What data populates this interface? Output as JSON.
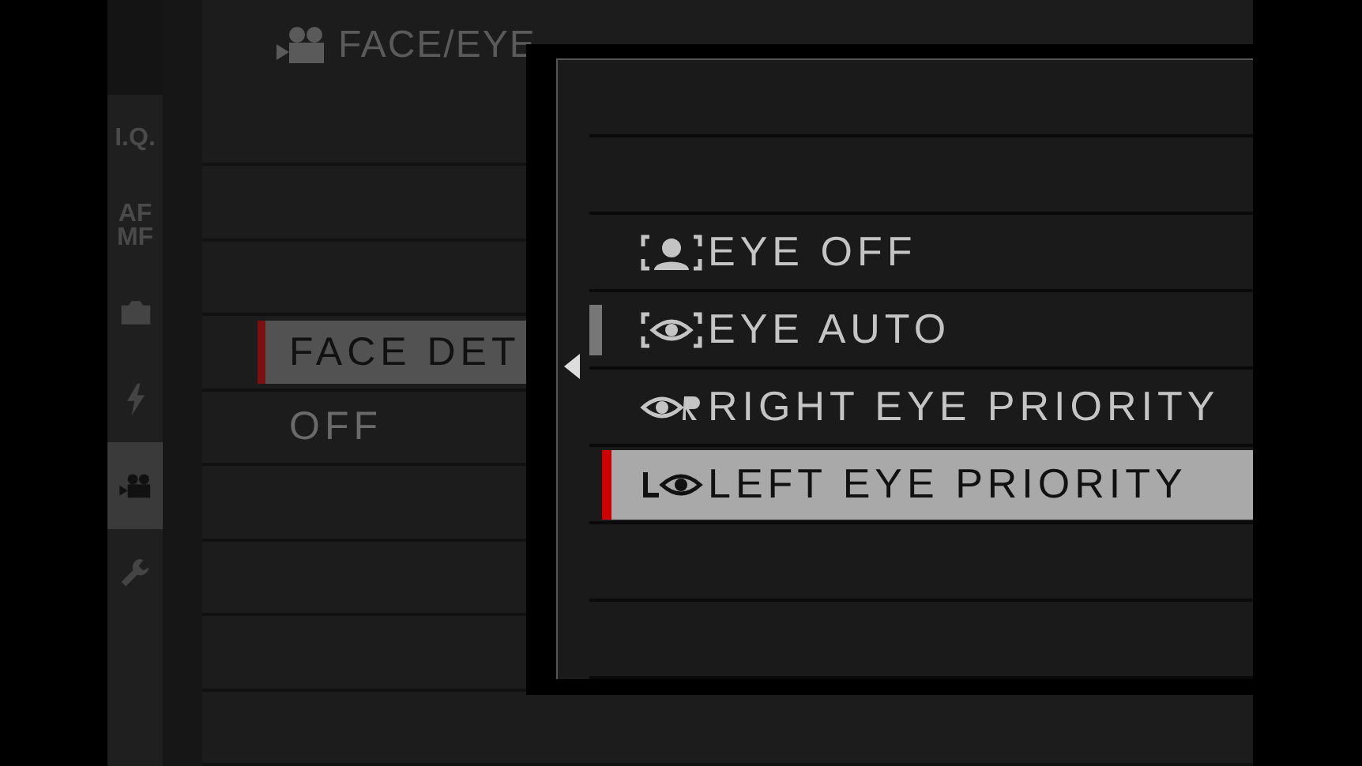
{
  "title": "FACE/EYE",
  "sidebar": {
    "tabs": [
      {
        "kind": "text",
        "lines": [
          "I.Q."
        ],
        "selected": false
      },
      {
        "kind": "text",
        "lines": [
          "AF",
          "MF"
        ],
        "selected": false
      },
      {
        "kind": "camera",
        "selected": false
      },
      {
        "kind": "flash",
        "selected": false
      },
      {
        "kind": "movie",
        "selected": true
      },
      {
        "kind": "wrench",
        "selected": false
      }
    ]
  },
  "menu_items": [
    {
      "label": "FACE DET",
      "selected": true
    },
    {
      "label": "OFF",
      "selected": false
    }
  ],
  "popup": {
    "options": [
      {
        "kind": "off",
        "label": "EYE OFF",
        "selected": false
      },
      {
        "kind": "auto",
        "label": "EYE AUTO",
        "selected": false
      },
      {
        "kind": "right",
        "label": "RIGHT EYE PRIORITY",
        "selected": false
      },
      {
        "kind": "left",
        "label": "LEFT EYE PRIORITY",
        "selected": true
      }
    ]
  }
}
